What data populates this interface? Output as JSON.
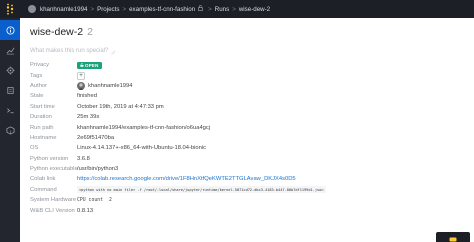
{
  "breadcrumbs": {
    "user": "khanhnamle1994",
    "projects": "Projects",
    "project": "examples-tf-cnn-fashion",
    "runs": "Runs",
    "run": "wise-dew-2"
  },
  "run": {
    "title": "wise-dew-2",
    "number": "2",
    "notes_placeholder": "What makes this run special?"
  },
  "fields": {
    "privacy": {
      "label": "Privacy",
      "value": "OPEN"
    },
    "tags": {
      "label": "Tags",
      "add": "+"
    },
    "author": {
      "label": "Author",
      "value": "khanhnamle1994"
    },
    "state": {
      "label": "State",
      "value": "finished"
    },
    "start_time": {
      "label": "Start time",
      "value": "October 19th, 2019 at 4:47:33 pm"
    },
    "duration": {
      "label": "Duration",
      "value": "25m 39s"
    },
    "run_path": {
      "label": "Run path",
      "value": "khanhnamle1994/examples-tf-cnn-fashion/o6ua4gcj"
    },
    "hostname": {
      "label": "Hostname",
      "value": "2e69f51470ba"
    },
    "os": {
      "label": "OS",
      "value": "Linux-4.14.137+-x86_64-with-Ubuntu-18.04-bionic"
    },
    "python_version": {
      "label": "Python version",
      "value": "3.6.8"
    },
    "python_executable": {
      "label": "Python executable",
      "value": "/usr/bin/python3"
    },
    "colab_link": {
      "label": "Colab link",
      "value": "https://colab.research.google.com/drive/1F8HnXtfQeKWTE2TTGLAvaw_DKJX4s0D5"
    },
    "command": {
      "label": "Command",
      "value": "<python with no main file> -f /root/.local/share/jupyter/runtime/kernel-5871cd72-dbc3-4183-b447-80b7df1199d1.json"
    },
    "system_hardware": {
      "label": "System Hardware",
      "key": "CPU count",
      "value": "2"
    },
    "wandb_version": {
      "label": "W&B CLI Version",
      "value": "0.8.13"
    }
  },
  "icons": {
    "logo": "wandb-logo-icon",
    "sidebar": [
      "info-icon",
      "chart-icon",
      "cpu-icon",
      "files-icon",
      "terminal-icon",
      "artifacts-icon"
    ]
  },
  "colors": {
    "topbar": "#1c1f26",
    "sidebar": "#23262e",
    "active": "#0b5fcc",
    "badge": "#1aa37a",
    "link": "#1976d2"
  }
}
